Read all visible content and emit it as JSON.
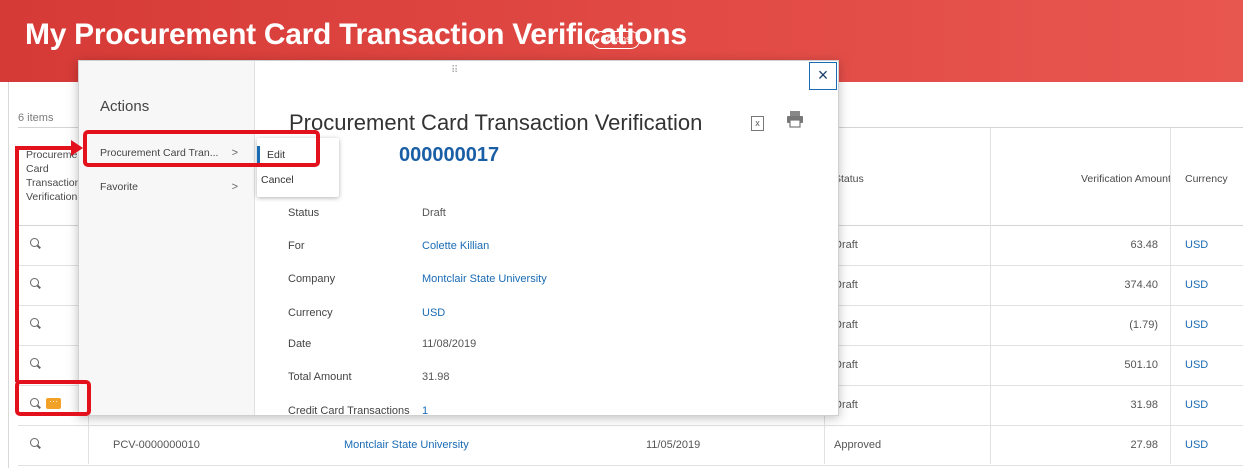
{
  "header": {
    "title": "My Procurement Card Transaction Verifications",
    "actions_label": "Actions"
  },
  "grid": {
    "items_count": "6 items",
    "columns": {
      "pcv": "Procurement Card Transaction Verification",
      "status": "Status",
      "amount": "Verification Amount",
      "currency": "Currency"
    },
    "rows": [
      {
        "status": "Draft",
        "amount": "63.48",
        "currency": "USD"
      },
      {
        "status": "Draft",
        "amount": "374.40",
        "currency": "USD"
      },
      {
        "status": "Draft",
        "amount": "(1.79)",
        "currency": "USD"
      },
      {
        "status": "Draft",
        "amount": "501.10",
        "currency": "USD"
      },
      {
        "status": "Draft",
        "amount": "31.98",
        "currency": "USD"
      },
      {
        "id": "PCV-0000000010",
        "company": "Montclair State University",
        "date": "11/05/2019",
        "status": "Approved",
        "amount": "27.98",
        "currency": "USD"
      }
    ]
  },
  "overlay": {
    "menu_title": "Actions",
    "menu_items": [
      {
        "label": "Procurement Card Tran...",
        "chevron": ">"
      },
      {
        "label": "Favorite",
        "chevron": ">"
      }
    ],
    "submenu": [
      "Edit",
      "Cancel"
    ],
    "detail_title": "Procurement Card Transaction Verification",
    "detail_id": "000000017",
    "close_glyph": "×",
    "excel_glyph": "x",
    "drag_glyph": "⠿",
    "fields": [
      {
        "label": "Status",
        "value": "Draft",
        "link": false
      },
      {
        "label": "For",
        "value": "Colette Killian",
        "link": true
      },
      {
        "label": "Company",
        "value": "Montclair State University",
        "link": true
      },
      {
        "label": "Currency",
        "value": "USD",
        "link": true
      },
      {
        "label": "Date",
        "value": "11/08/2019",
        "link": false
      },
      {
        "label": "Total Amount",
        "value": "31.98",
        "link": false
      },
      {
        "label": "Credit Card Transactions",
        "value": "1",
        "link": true
      }
    ]
  },
  "colors": {
    "header_red": "#e24b46",
    "link_blue": "#1a6bb5",
    "callout_red": "#e3111b",
    "badge_orange": "#f2a127"
  },
  "icons": [
    "search-icon",
    "related-actions-icon",
    "close-icon",
    "excel-icon",
    "print-icon",
    "chevron-right-icon",
    "drag-handle-icon"
  ]
}
